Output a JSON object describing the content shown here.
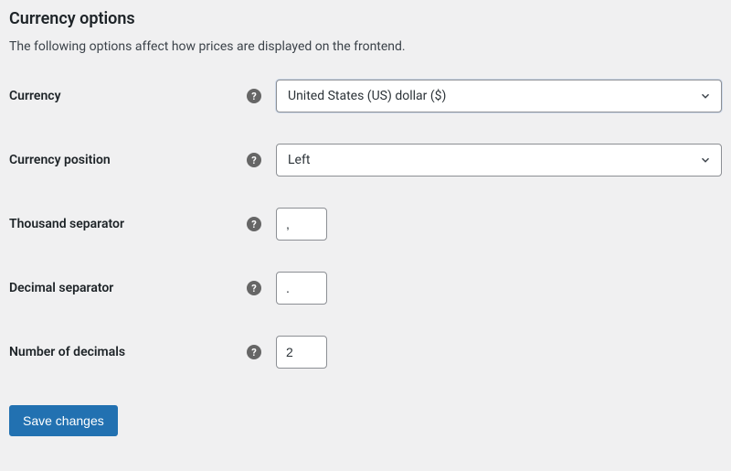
{
  "heading": "Currency options",
  "description": "The following options affect how prices are displayed on the frontend.",
  "fields": {
    "currency": {
      "label": "Currency",
      "value": "United States (US) dollar ($)"
    },
    "currency_position": {
      "label": "Currency position",
      "value": "Left"
    },
    "thousand_separator": {
      "label": "Thousand separator",
      "value": ","
    },
    "decimal_separator": {
      "label": "Decimal separator",
      "value": "."
    },
    "number_of_decimals": {
      "label": "Number of decimals",
      "value": "2"
    }
  },
  "save_button": "Save changes"
}
